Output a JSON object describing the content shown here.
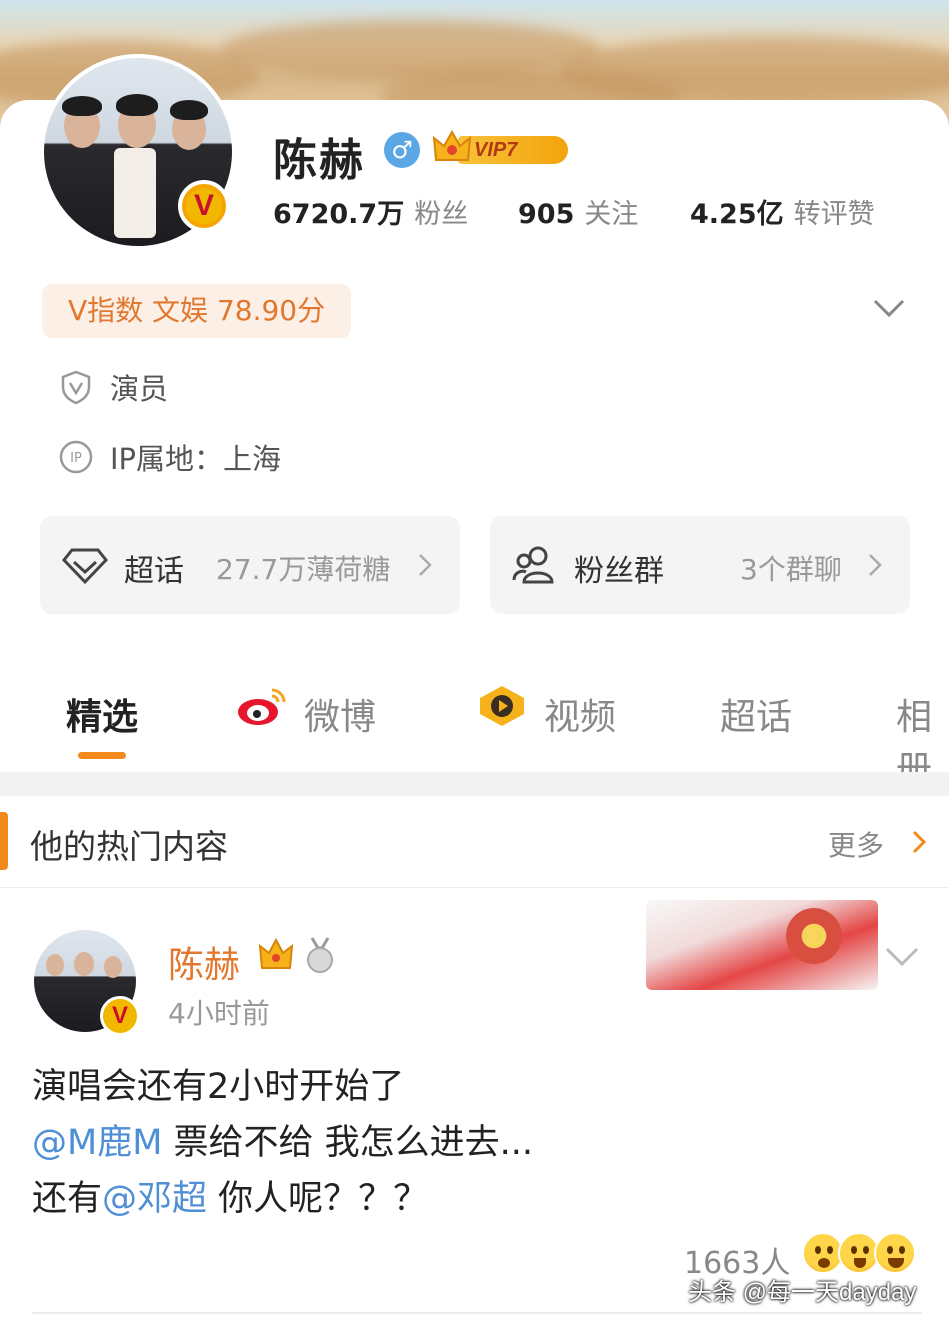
{
  "profile": {
    "name": "陈赫",
    "vip_label": "VIP7",
    "stats": [
      {
        "value": "6720.7万",
        "label": "粉丝"
      },
      {
        "value": "905",
        "label": "关注"
      },
      {
        "value": "4.25亿",
        "label": "转评赞"
      }
    ],
    "v_index": "V指数 文娱 78.90分",
    "occupation": "演员",
    "ip_location": "IP属地：上海"
  },
  "cards": {
    "super_topic": {
      "title": "超话",
      "sub": "27.7万薄荷糖"
    },
    "fan_group": {
      "title": "粉丝群",
      "sub": "3个群聊"
    }
  },
  "tabs": [
    "精选",
    "微博",
    "视频",
    "超话",
    "相册"
  ],
  "section": {
    "title": "他的热门内容",
    "more": "更多"
  },
  "post": {
    "author": "陈赫",
    "time": "4小时前",
    "line1": "演唱会还有2小时开始了",
    "line2_mention": "@M鹿M",
    "line2_rest": " 票给不给 我怎么进去...",
    "line3_prefix": "还有",
    "line3_mention": "@邓超",
    "line3_rest": " 你人呢？？？",
    "likes": "1663人"
  },
  "watermark": "头条 @每一天dayday",
  "colors": {
    "accent": "#f28a1c",
    "mention": "#4f8fd6",
    "vip_gold": "#f3a30c"
  }
}
